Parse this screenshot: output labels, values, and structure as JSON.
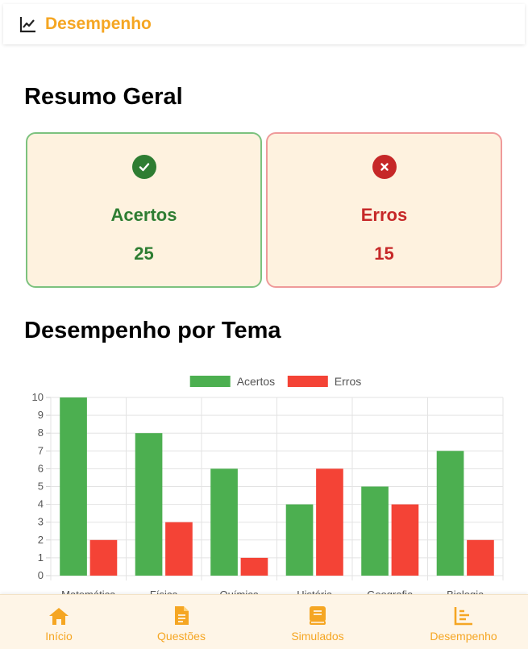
{
  "header": {
    "title": "Desempenho",
    "icon": "chart-line-icon"
  },
  "summary": {
    "title": "Resumo Geral",
    "correct": {
      "label": "Acertos",
      "value": "25",
      "icon": "check-circle-icon",
      "color": "#2e7d32"
    },
    "wrong": {
      "label": "Erros",
      "value": "15",
      "icon": "x-circle-icon",
      "color": "#c62828"
    }
  },
  "by_theme": {
    "title": "Desempenho por Tema"
  },
  "chart_data": {
    "type": "bar",
    "categories": [
      "Matemática",
      "Física",
      "Química",
      "História",
      "Geografia",
      "Biologia"
    ],
    "series": [
      {
        "name": "Acertos",
        "values": [
          10,
          8,
          6,
          4,
          5,
          7
        ],
        "color": "#4caf50"
      },
      {
        "name": "Erros",
        "values": [
          2,
          3,
          1,
          6,
          4,
          2
        ],
        "color": "#f44336"
      }
    ],
    "ylim": [
      0,
      10
    ],
    "yticks": [
      "0",
      "1",
      "2",
      "3",
      "4",
      "5",
      "6",
      "7",
      "8",
      "9",
      "10"
    ],
    "grid": true,
    "legend": "top"
  },
  "nav": {
    "items": [
      {
        "label": "Início",
        "icon": "home-icon"
      },
      {
        "label": "Questões",
        "icon": "document-icon"
      },
      {
        "label": "Simulados",
        "icon": "book-icon"
      },
      {
        "label": "Desempenho",
        "icon": "chart-bar-icon"
      }
    ],
    "color": "#f5a623"
  }
}
